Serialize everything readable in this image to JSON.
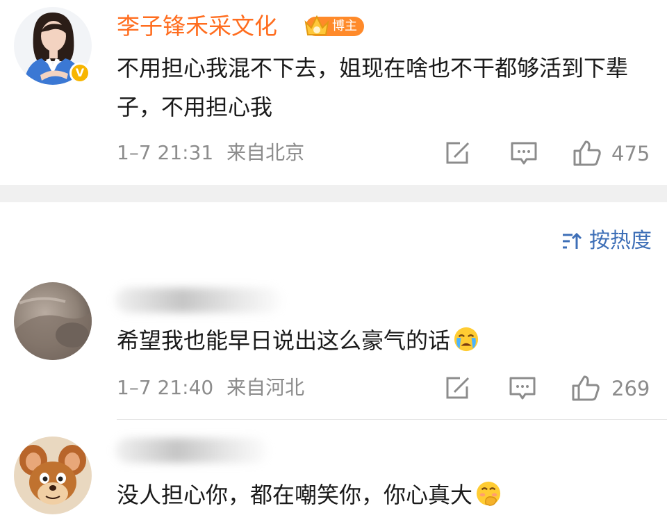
{
  "comments": [
    {
      "username": "李子锋禾采文化",
      "badge": "博主",
      "verified": true,
      "text": "不用担心我混不下去，姐现在啥也不干都够活到下辈子，不用担心我",
      "time": "1–7 21:31",
      "location": "来自北京",
      "likes": "475"
    },
    {
      "username_obscured": true,
      "text": "希望我也能早日说出这么豪气的话",
      "emoji": "crying-face",
      "time": "1–7 21:40",
      "location": "来自河北",
      "likes": "269"
    },
    {
      "username_obscured": true,
      "text": "没人担心你，都在嘲笑你，你心真大",
      "emoji": "hand-over-mouth-face"
    }
  ],
  "sort": {
    "label": "按热度",
    "icon": "sort-icon"
  },
  "colors": {
    "username_orange": "#ff6d1f",
    "badge_orange": "#ff8a2a",
    "verified_yellow": "#f7b500",
    "meta_gray": "#8c8c8c",
    "sort_blue": "#3e6fb7",
    "separator_gray": "#f0f0f0"
  },
  "icons": [
    "repost-icon",
    "comment-icon",
    "like-icon",
    "verified-icon",
    "crown-icon"
  ]
}
